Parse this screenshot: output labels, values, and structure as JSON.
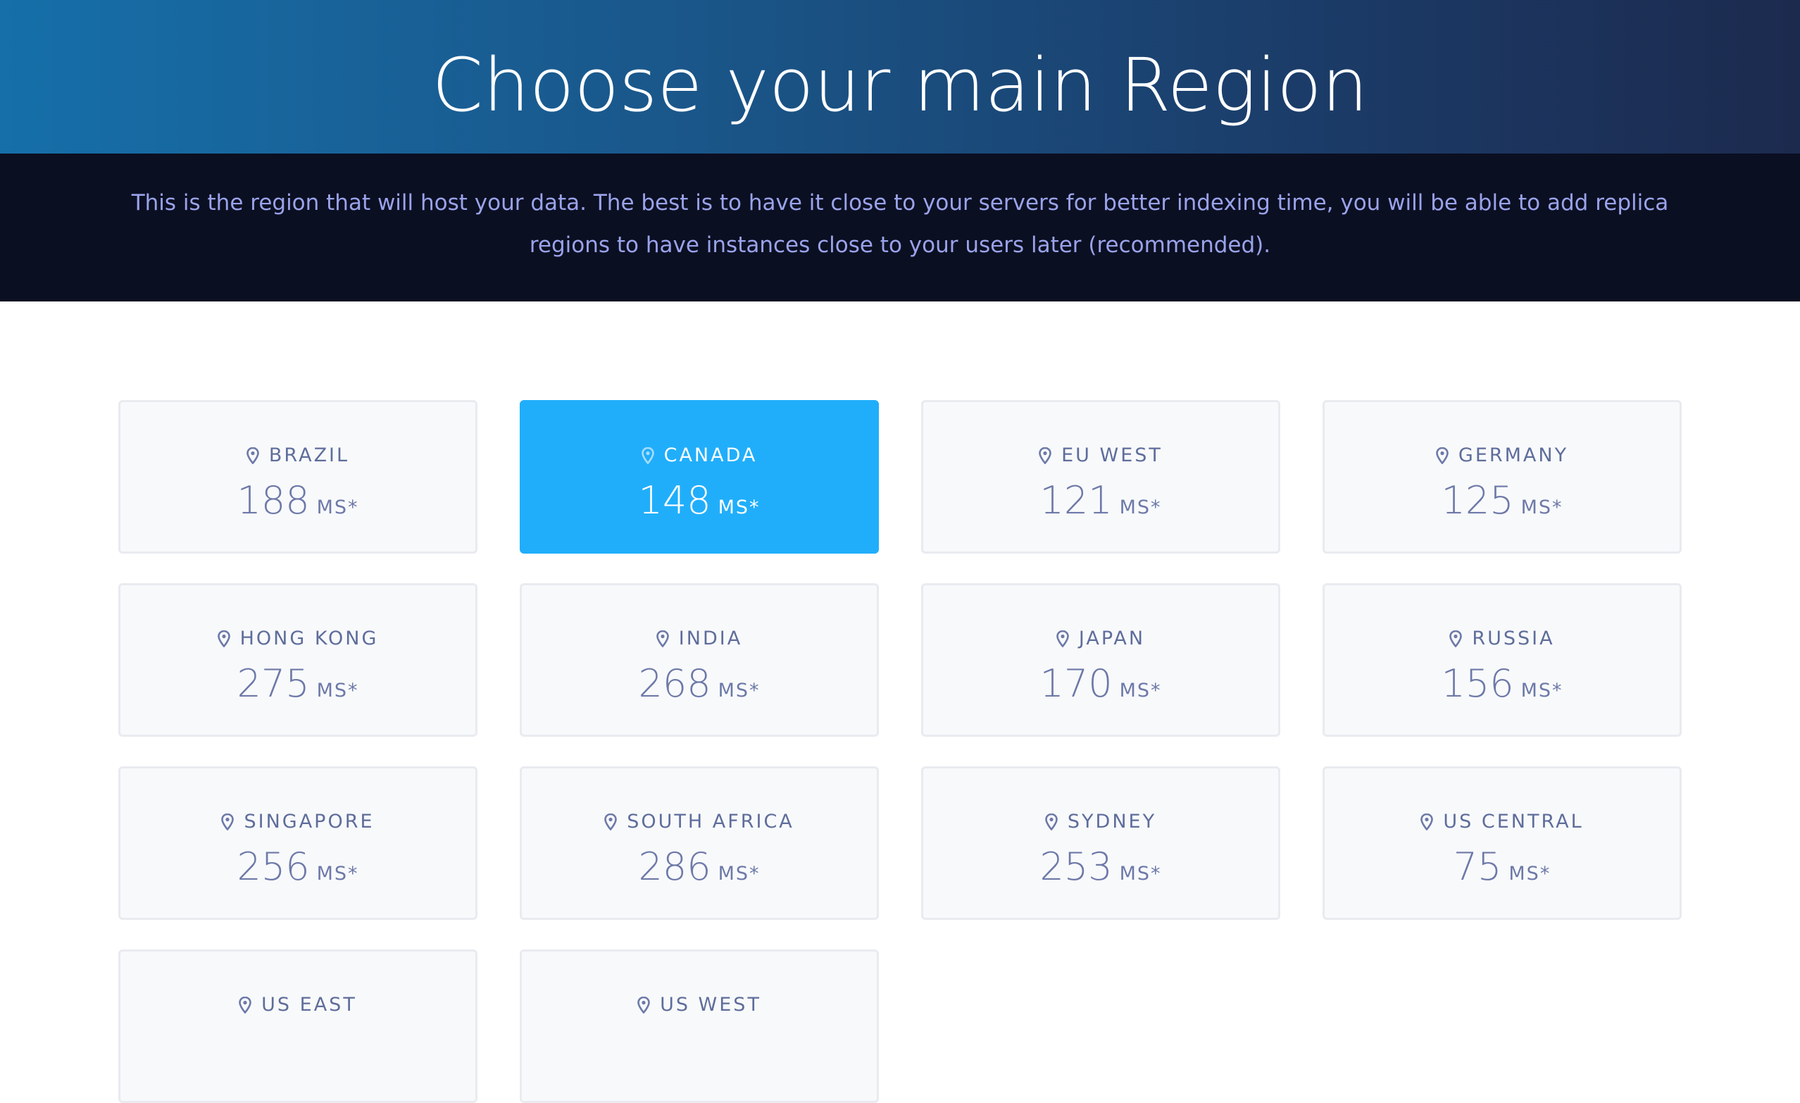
{
  "header": {
    "title": "Choose your main Region"
  },
  "description": "This is the region that will host your data. The best is to have it close to your servers for better indexing time, you will be able to add replica regions to have instances close to your users later (recommended).",
  "colors": {
    "accent": "#20aefb",
    "header_start": "#166fa9",
    "header_end": "#1c2a4e",
    "subheader_bg": "#0b0f22",
    "subheader_text": "#9aa3ea",
    "card_bg": "#f8f9fb",
    "card_text": "#6d79a8"
  },
  "regions": [
    {
      "name": "BRAZIL",
      "latency": "188",
      "unit": "MS*",
      "selected": false,
      "icon": "map-pin-icon"
    },
    {
      "name": "CANADA",
      "latency": "148",
      "unit": "MS*",
      "selected": true,
      "icon": "map-pin-icon"
    },
    {
      "name": "EU WEST",
      "latency": "121",
      "unit": "MS*",
      "selected": false,
      "icon": "map-pin-icon"
    },
    {
      "name": "GERMANY",
      "latency": "125",
      "unit": "MS*",
      "selected": false,
      "icon": "map-pin-icon"
    },
    {
      "name": "HONG KONG",
      "latency": "275",
      "unit": "MS*",
      "selected": false,
      "icon": "map-pin-icon"
    },
    {
      "name": "INDIA",
      "latency": "268",
      "unit": "MS*",
      "selected": false,
      "icon": "map-pin-icon"
    },
    {
      "name": "JAPAN",
      "latency": "170",
      "unit": "MS*",
      "selected": false,
      "icon": "map-pin-icon"
    },
    {
      "name": "RUSSIA",
      "latency": "156",
      "unit": "MS*",
      "selected": false,
      "icon": "map-pin-icon"
    },
    {
      "name": "SINGAPORE",
      "latency": "256",
      "unit": "MS*",
      "selected": false,
      "icon": "map-pin-icon"
    },
    {
      "name": "SOUTH AFRICA",
      "latency": "286",
      "unit": "MS*",
      "selected": false,
      "icon": "map-pin-icon"
    },
    {
      "name": "SYDNEY",
      "latency": "253",
      "unit": "MS*",
      "selected": false,
      "icon": "map-pin-icon"
    },
    {
      "name": "US CENTRAL",
      "latency": "75",
      "unit": "MS*",
      "selected": false,
      "icon": "map-pin-icon"
    },
    {
      "name": "US EAST",
      "latency": "",
      "unit": "",
      "selected": false,
      "icon": "map-pin-icon"
    },
    {
      "name": "US WEST",
      "latency": "",
      "unit": "",
      "selected": false,
      "icon": "map-pin-icon"
    }
  ]
}
